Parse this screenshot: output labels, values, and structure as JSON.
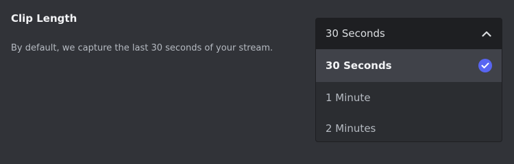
{
  "setting": {
    "title": "Clip Length",
    "description": "By default, we capture the last 30 seconds of your stream."
  },
  "dropdown": {
    "selected_value": "30 Seconds",
    "expanded": true,
    "chevron_icon": "chevron-up-icon",
    "options": [
      {
        "label": "30 Seconds",
        "selected": true,
        "icon": "check-circle-icon"
      },
      {
        "label": "1 Minute",
        "selected": false
      },
      {
        "label": "2 Minutes",
        "selected": false
      }
    ]
  },
  "colors": {
    "background": "#313338",
    "select_background": "#1e1f22",
    "menu_background": "#2b2d31",
    "selected_row": "#404249",
    "accent": "#5865f2"
  }
}
